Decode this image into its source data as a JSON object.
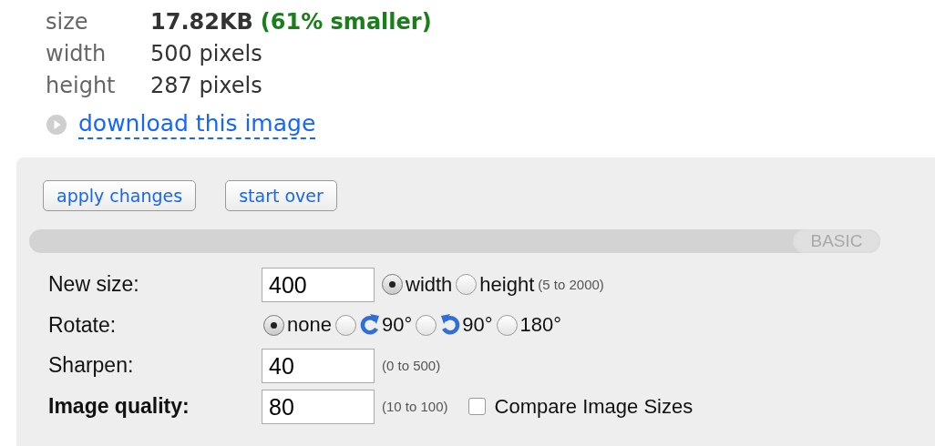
{
  "info": [
    {
      "label": "size",
      "value": "17.82KB",
      "note": "(61% smaller)"
    },
    {
      "label": "width",
      "value": "500 pixels"
    },
    {
      "label": "height",
      "value": "287 pixels"
    }
  ],
  "download_link": "download this image",
  "buttons": [
    "apply changes",
    "start over"
  ],
  "mode_tab": "BASIC",
  "rows": [
    {
      "label": "New size:",
      "bold": false,
      "controls": [
        {
          "kind": "input",
          "value": "400"
        },
        {
          "kind": "radio",
          "label": "width",
          "selected": true
        },
        {
          "kind": "radio",
          "label": "height",
          "selected": false
        },
        {
          "kind": "hint",
          "text": "(5 to 2000)"
        }
      ]
    },
    {
      "label": "Rotate:",
      "bold": false,
      "controls": [
        {
          "kind": "radio",
          "label": "none",
          "selected": true
        },
        {
          "kind": "radio_cw",
          "label": "90°",
          "selected": false
        },
        {
          "kind": "radio_ccw",
          "label": "90°",
          "selected": false
        },
        {
          "kind": "radio",
          "label": "180°",
          "selected": false
        }
      ]
    },
    {
      "label": "Sharpen:",
      "bold": false,
      "controls": [
        {
          "kind": "input",
          "value": "40"
        },
        {
          "kind": "hint",
          "text": "(0 to 500)"
        }
      ]
    },
    {
      "label": "Image quality:",
      "bold": true,
      "controls": [
        {
          "kind": "input",
          "value": "80"
        },
        {
          "kind": "hint",
          "text": "(10 to 100)"
        },
        {
          "kind": "checkbox",
          "label": "Compare Image Sizes",
          "checked": false
        }
      ]
    }
  ]
}
